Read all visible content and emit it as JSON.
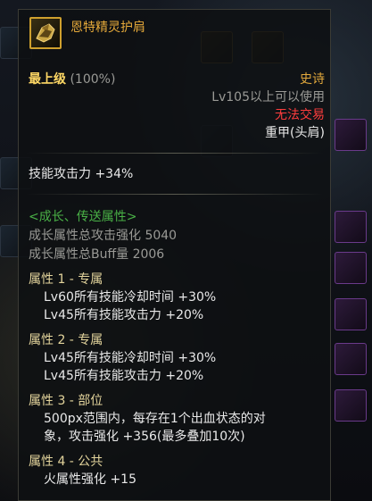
{
  "item": {
    "name": "恩特精灵护肩",
    "icon": "shoulder-armor-icon",
    "grade": "最上级",
    "grade_pct": "(100%)",
    "rarity": "史诗",
    "level_req": "Lv105以上可以使用",
    "trade": "无法交易",
    "type": "重甲(头肩)",
    "skill_attack": "技能攻击力 +34%",
    "growth_title": "<成长、传送属性>",
    "growth_attack": "成长属性总攻击强化 5040",
    "growth_buff": "成长属性总Buff量 2006",
    "attr1_title": "属性 1 - 专属",
    "attr1_line1": "Lv60所有技能冷却时间 +30%",
    "attr1_line2": "Lv45所有技能攻击力 +20%",
    "attr2_title": "属性 2 - 专属",
    "attr2_line1": "Lv45所有技能冷却时间 +30%",
    "attr2_line2": "Lv45所有技能攻击力 +20%",
    "attr3_title": "属性 3 - 部位",
    "attr3_line1": "500px范围内，每存在1个出血状态的对",
    "attr3_line2": "象，攻击强化 +356(最多叠加10次)",
    "attr4_title": "属性 4 - 公共",
    "attr4_line1": "火属性强化 +15"
  },
  "colors": {
    "rarity_orange": "#e0a73c",
    "grade_yellow": "#ffd865",
    "untradable_red": "#ff3d3d",
    "growth_green": "#49b046"
  }
}
